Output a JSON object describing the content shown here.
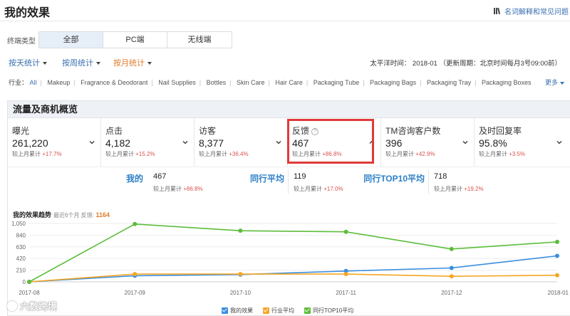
{
  "header": {
    "title": "我的效果",
    "help_link": "名词解释和常见问题"
  },
  "terminal": {
    "label": "终端类型",
    "tabs": [
      "全部",
      "PC端",
      "无线端"
    ],
    "active_index": 0
  },
  "periods": [
    "按天统计",
    "按周统计",
    "按月统计"
  ],
  "active_period": 2,
  "time_info": "太平洋时间： 2018-01 （更新周期：北京时间每月3号09:00前）",
  "industry": {
    "label": "行业：",
    "items": [
      "All",
      "Makeup",
      "Fragrance & Deodorant",
      "Nail Supplies",
      "Bottles",
      "Skin Care",
      "Hair Care",
      "Packaging Tube",
      "Packaging Bags",
      "Packaging Tray",
      "Packaging Boxes"
    ],
    "more": "更多"
  },
  "section_title": "流量及商机概览",
  "cards": [
    {
      "title": "曝光",
      "value": "261,220",
      "cmp_label": "较上月累计",
      "pct": "+17.7%"
    },
    {
      "title": "点击",
      "value": "4,182",
      "cmp_label": "较上月累计",
      "pct": "+15.2%"
    },
    {
      "title": "访客",
      "value": "8,377",
      "cmp_label": "较上月累计",
      "pct": "+36.4%"
    },
    {
      "title": "反馈",
      "value": "467",
      "cmp_label": "较上月累计",
      "pct": "+86.8%"
    },
    {
      "title": "TM咨询客户数",
      "value": "396",
      "cmp_label": "较上月累计",
      "pct": "+42.9%"
    },
    {
      "title": "及时回复率",
      "value": "95.8%",
      "cmp_label": "较上月累计",
      "pct": "+3.5%"
    }
  ],
  "comparison": [
    {
      "label": "我的",
      "value": "467",
      "cmp_label": "较上月累计",
      "pct": "+86.8%"
    },
    {
      "label": "同行平均",
      "value": "119",
      "cmp_label": "较上月累计",
      "pct": "+17.0%"
    },
    {
      "label": "同行TOP10平均",
      "value": "718",
      "cmp_label": "较上月累计",
      "pct": "+19.2%"
    }
  ],
  "chart_header": {
    "title": "我的效果趋势",
    "sub": "最近6个月 反馈:",
    "feedback_total": "1164"
  },
  "colors": {
    "mine": "#3a8ee0",
    "industry": "#f5a623",
    "top10": "#5cbd3a",
    "accent": "#3a6fb0",
    "highlight": "#e03a3a"
  },
  "chart_data": {
    "type": "line",
    "title": "我的效果趋势",
    "x": [
      "2017-08",
      "2017-09",
      "2017-10",
      "2017-11",
      "2017-12",
      "2018-01"
    ],
    "y_ticks": [
      "0",
      "210",
      "420",
      "630",
      "840",
      "1,050"
    ],
    "ylim": [
      0,
      1050
    ],
    "grid": true,
    "legend_placement": "bottom",
    "series": [
      {
        "name": "我的效果",
        "color": "#3a8ee0",
        "values": [
          0,
          110,
          130,
          195,
          250,
          467
        ]
      },
      {
        "name": "行业平均",
        "color": "#f5a623",
        "values": [
          0,
          140,
          140,
          140,
          100,
          119
        ]
      },
      {
        "name": "同行TOP10平均",
        "color": "#5cbd3a",
        "values": [
          0,
          1040,
          920,
          900,
          590,
          718
        ]
      }
    ]
  },
  "watermark": "六数跨境"
}
